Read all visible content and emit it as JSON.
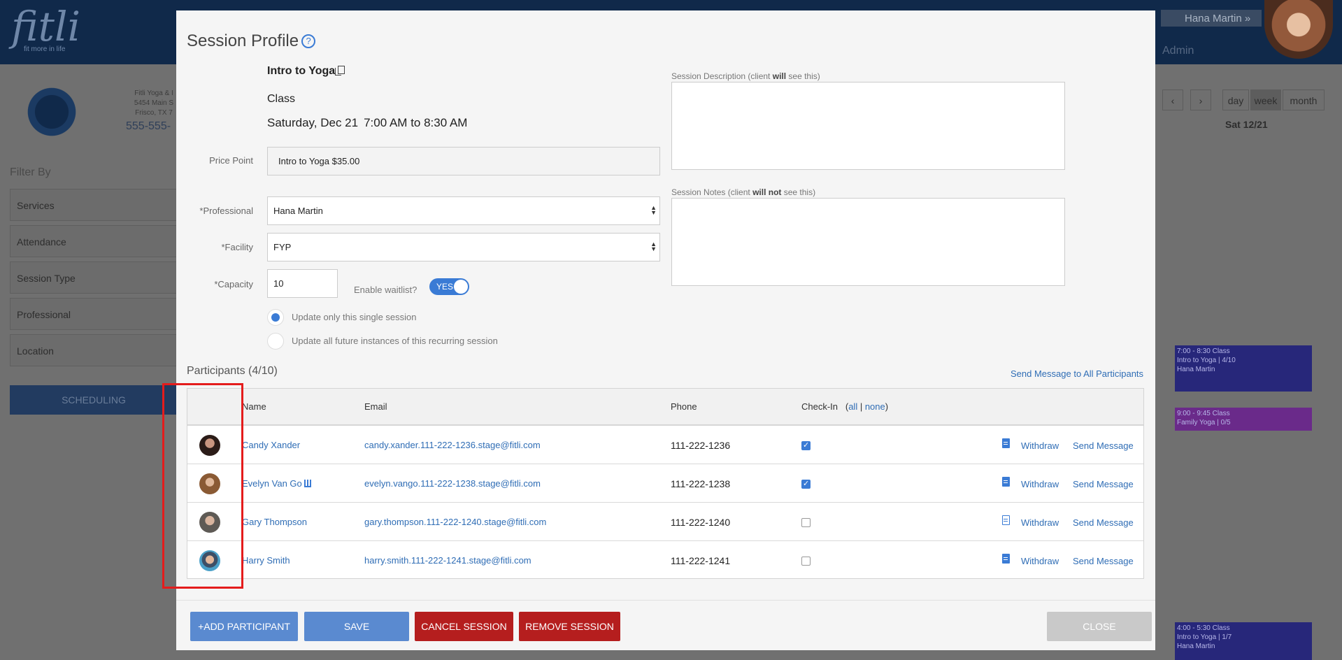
{
  "background": {
    "logo": "fitli",
    "logo_tagline": "fit more in life",
    "user_name": "Hana Martin",
    "user_role": "Admin",
    "company_lines": [
      "Fitli Yoga & I",
      "5454 Main S",
      "Frisco, TX 7"
    ],
    "company_phone": "555-555-",
    "filter_label": "Filter By",
    "filters": [
      "Services",
      "Attendance",
      "Session Type",
      "Professional",
      "Location"
    ],
    "scheduling_label": "SCHEDULING",
    "view_buttons": [
      "day",
      "week",
      "month"
    ],
    "date_heading": "Sat 12/21",
    "events": [
      {
        "time": "7:00 - 8:30 Class",
        "title": "Intro to Yoga | 4/10",
        "pro": "Hana Martin"
      },
      {
        "time": "9:00 - 9:45 Class",
        "title": "Family Yoga | 0/5",
        "pro": ""
      },
      {
        "time": "4:00 - 5:30 Class",
        "title": "Intro to Yoga | 1/7",
        "pro": "Hana Martin"
      }
    ]
  },
  "modal": {
    "title": "Session Profile",
    "session_name": "Intro to Yoga",
    "session_type": "Class",
    "session_date": "Saturday, Dec 21",
    "session_time": "7:00 AM to 8:30 AM",
    "price_point": {
      "label": "Price Point",
      "value": "Intro to Yoga $35.00"
    },
    "professional": {
      "label": "*Professional",
      "value": "Hana Martin"
    },
    "facility": {
      "label": "*Facility",
      "value": "FYP"
    },
    "capacity": {
      "label": "*Capacity",
      "value": "10"
    },
    "waitlist": {
      "label": "Enable waitlist?",
      "value": "YES"
    },
    "update_options": [
      "Update only this single session",
      "Update all future instances of this recurring session"
    ],
    "description_label": {
      "pre": "Session Description (client ",
      "bold": "will",
      "post": " see this)"
    },
    "notes_label": {
      "pre": "Session Notes (client ",
      "bold": "will not",
      "post": " see this)"
    },
    "participants_title": "Participants (4/10)",
    "send_all": "Send Message to All Participants",
    "table_headers": {
      "name": "Name",
      "email": "Email",
      "phone": "Phone",
      "checkin": "Check-In",
      "all": "all",
      "none": "none"
    },
    "participants": [
      {
        "name": "Candy Xander",
        "email": "candy.xander.111-222-1236.stage@fitli.com",
        "phone": "111-222-1236",
        "checked": true,
        "withdraw": "Withdraw",
        "send": "Send Message"
      },
      {
        "name": "Evelyn Van Go",
        "email": "evelyn.vango.111-222-1238.stage@fitli.com",
        "phone": "111-222-1238",
        "checked": true,
        "withdraw": "Withdraw",
        "send": "Send Message"
      },
      {
        "name": "Gary Thompson",
        "email": "gary.thompson.111-222-1240.stage@fitli.com",
        "phone": "111-222-1240",
        "checked": false,
        "withdraw": "Withdraw",
        "send": "Send Message"
      },
      {
        "name": "Harry Smith",
        "email": "harry.smith.111-222-1241.stage@fitli.com",
        "phone": "111-222-1241",
        "checked": false,
        "withdraw": "Withdraw",
        "send": "Send Message"
      }
    ],
    "buttons": {
      "add": "+ADD PARTICIPANT",
      "save": "SAVE",
      "cancel": "CANCEL SESSION",
      "remove": "REMOVE SESSION",
      "close": "CLOSE"
    }
  },
  "colors": {
    "accent": "#3a7bd5",
    "danger": "#b51e1e",
    "highlight": "#e41c1c",
    "header": "#10294a"
  }
}
